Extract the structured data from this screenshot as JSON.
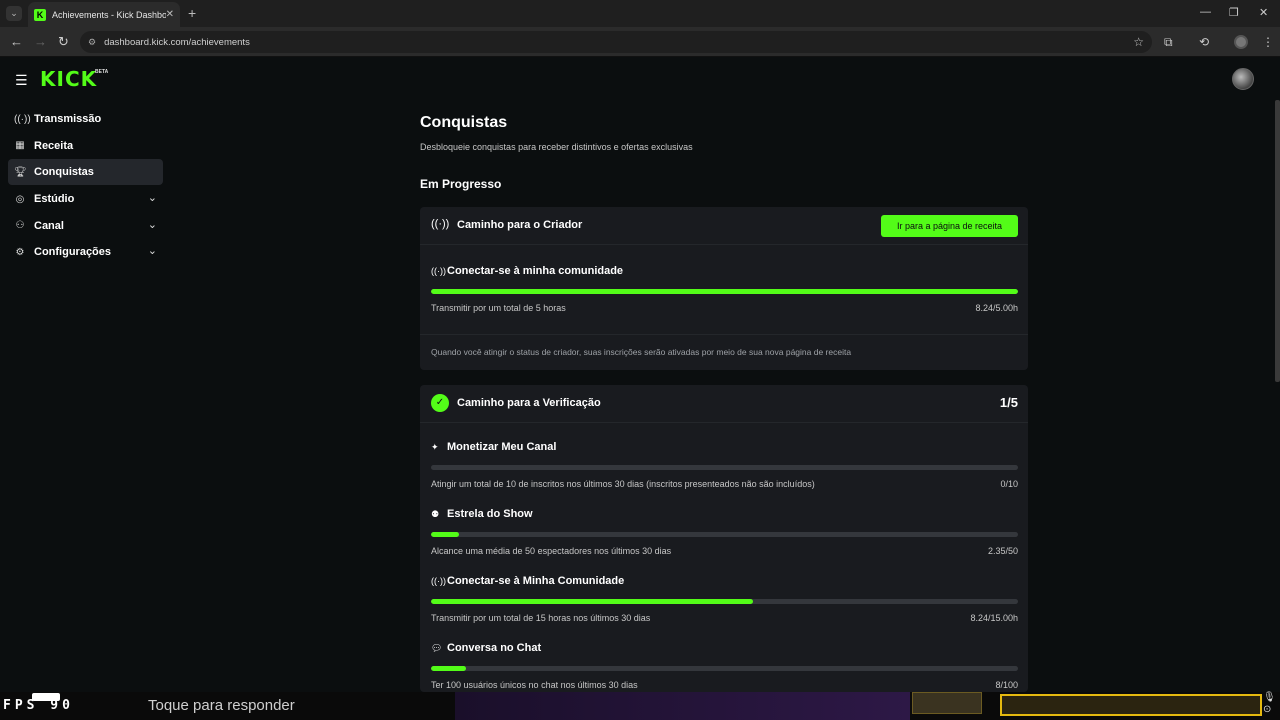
{
  "browser": {
    "tab_title": "Achievements - Kick Dashboard",
    "url": "dashboard.kick.com/achievements"
  },
  "app": {
    "logo": "KICK",
    "logo_badge": "BETA"
  },
  "sidebar": {
    "items": [
      {
        "label": "Transmissão",
        "icon": "broadcast-icon",
        "active": false,
        "expandable": false
      },
      {
        "label": "Receita",
        "icon": "revenue-icon",
        "active": false,
        "expandable": false
      },
      {
        "label": "Conquistas",
        "icon": "trophy-icon",
        "active": true,
        "expandable": false
      },
      {
        "label": "Estúdio",
        "icon": "studio-icon",
        "active": false,
        "expandable": true
      },
      {
        "label": "Canal",
        "icon": "channel-icon",
        "active": false,
        "expandable": true
      },
      {
        "label": "Configurações",
        "icon": "gear-icon",
        "active": false,
        "expandable": true
      }
    ]
  },
  "main": {
    "title": "Conquistas",
    "subtitle": "Desbloqueie conquistas para receber distintivos e ofertas exclusivas",
    "section": "Em Progresso",
    "creator_card": {
      "title": "Caminho para o Criador",
      "button": "Ir para a página de receita",
      "achievement": {
        "title": "Conectar-se à minha comunidade",
        "desc": "Transmitir por um total de 5 horas",
        "value": "8.24/5.00h",
        "progress": 1.0
      },
      "note": "Quando você atingir o status de criador, suas inscrições serão ativadas por meio de sua nova página de receita"
    },
    "verify_card": {
      "title": "Caminho para a Verificação",
      "count": "1/5",
      "achievements": [
        {
          "title": "Monetizar Meu Canal",
          "icon": "sparkle-icon",
          "desc": "Atingir um total de 10 de inscritos nos últimos 30 dias (inscritos presenteados não são incluídos)",
          "value": "0/10",
          "progress": 0.0
        },
        {
          "title": "Estrela do Show",
          "icon": "viewers-icon",
          "desc": "Alcance uma média de 50 espectadores nos últimos 30 dias",
          "value": "2.35/50",
          "progress": 0.047
        },
        {
          "title": "Conectar-se à Minha Comunidade",
          "icon": "broadcast-icon",
          "desc": "Transmitir por um total de 15 horas nos últimos 30 dias",
          "value": "8.24/15.00h",
          "progress": 0.549
        },
        {
          "title": "Conversa no Chat",
          "icon": "chat-icon",
          "desc": "Ter 100 usuários únicos no chat nos últimos 30 dias",
          "value": "8/100",
          "progress": 0.06
        }
      ]
    }
  },
  "overlay": {
    "fps": "FPS 90",
    "reply": "Toque para responder"
  }
}
